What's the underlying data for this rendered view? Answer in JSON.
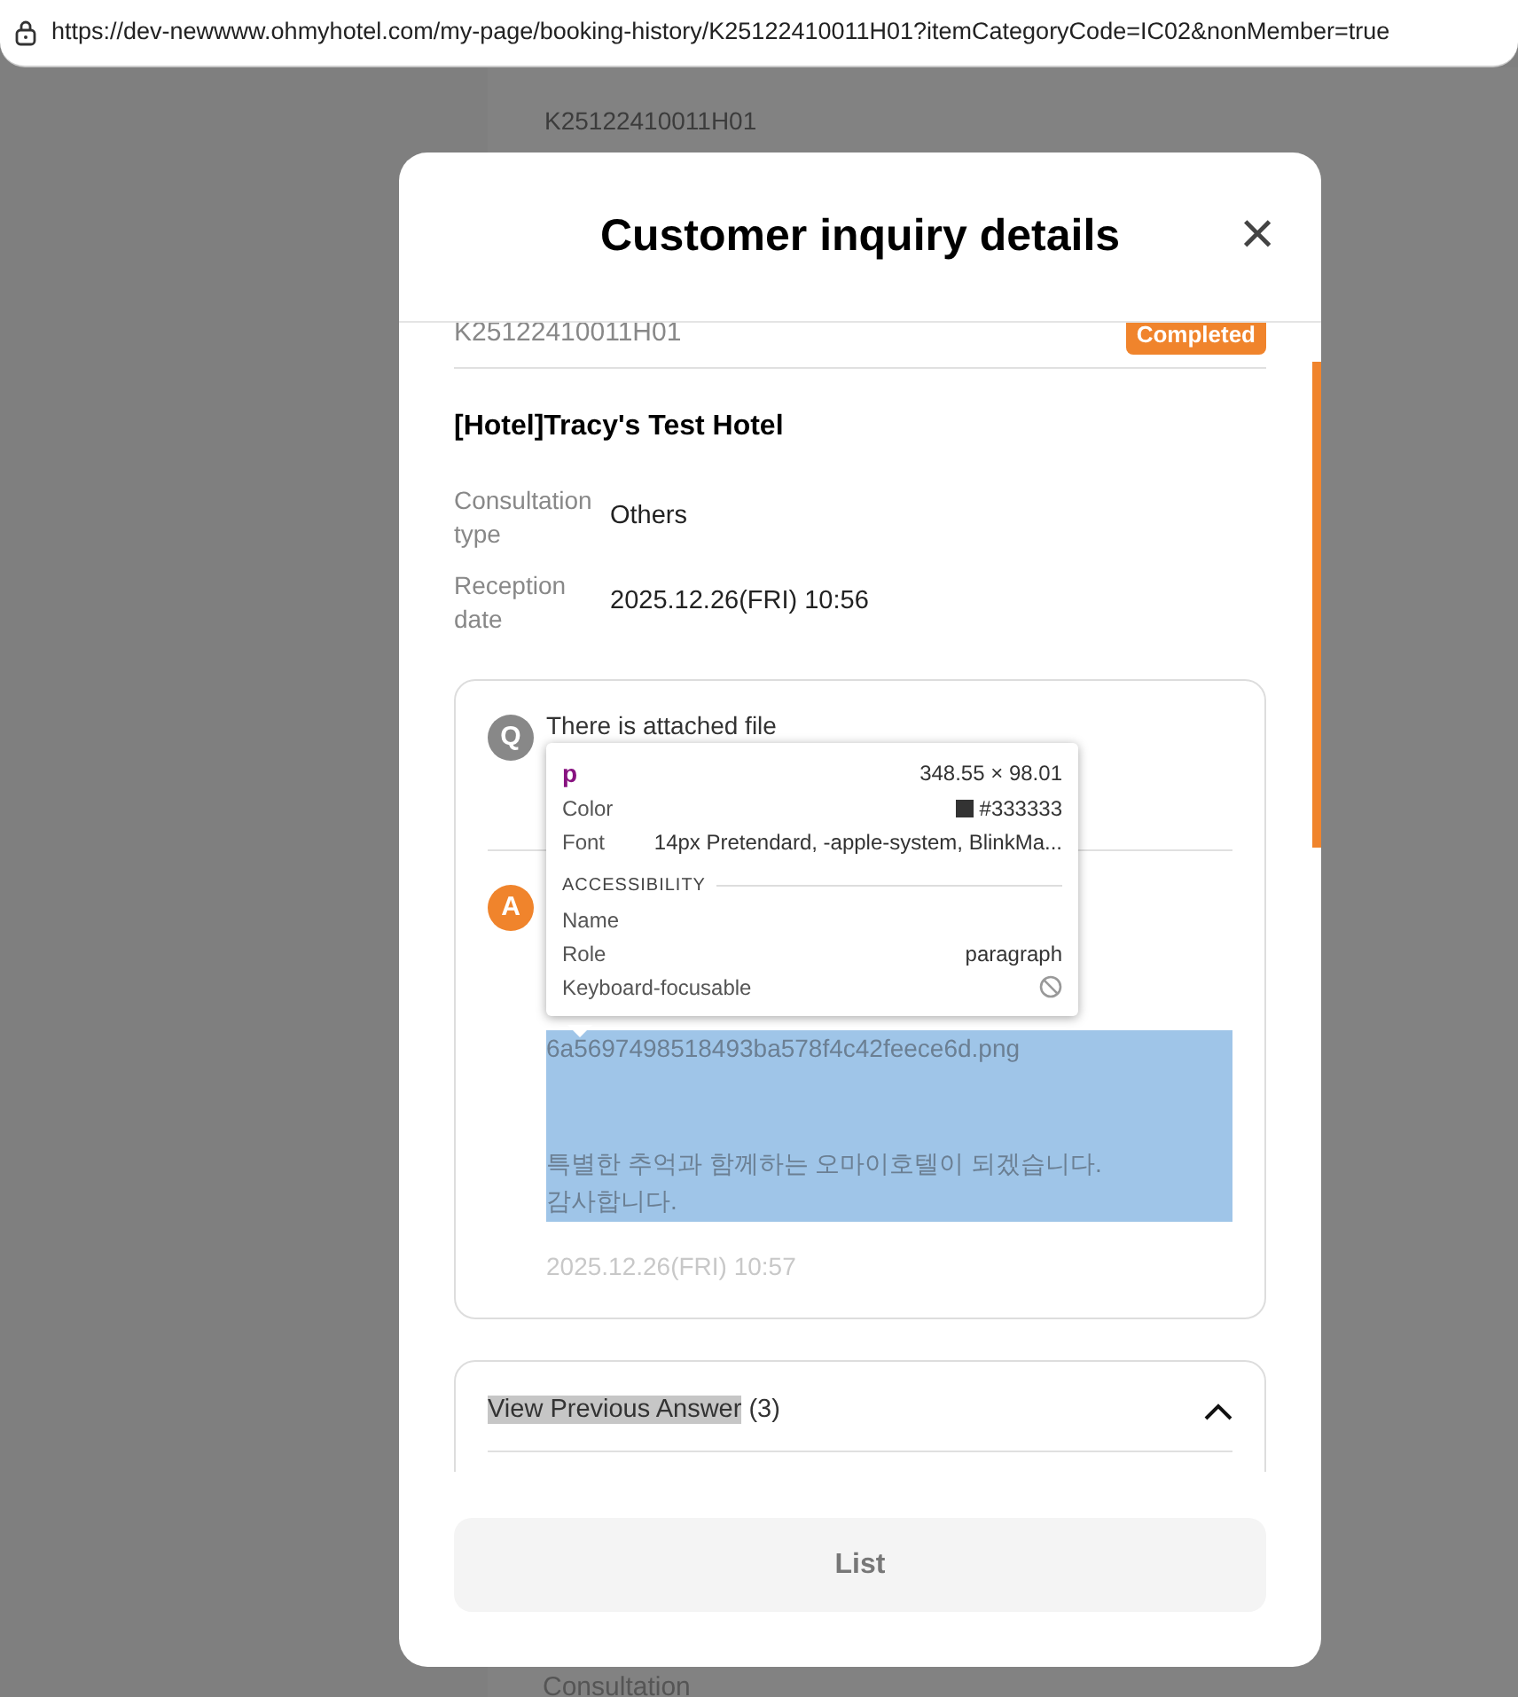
{
  "address_bar": {
    "url": "https://dev-newwww.ohmyhotel.com/my-page/booking-history/K25122410011H01?itemCategoryCode=IC02&nonMember=true"
  },
  "background_page": {
    "booking_number": "K25122410011H01",
    "bottom_label": "Consultation"
  },
  "modal": {
    "title": "Customer inquiry details",
    "close": "×",
    "reservation_number": "K25122410011H01",
    "status": {
      "label": "Completed",
      "color": "#f0842c"
    },
    "hotel_name": "[Hotel]Tracy's Test Hotel",
    "details": [
      {
        "label": "Consultation type",
        "value": "Others"
      },
      {
        "label": "Reception date",
        "value": "2025.12.26(FRI) 10:56"
      }
    ],
    "question": {
      "badge": "Q",
      "text": "There is attached file"
    },
    "answer": {
      "badge": "A",
      "highlighted": true,
      "file": "6a5697498518493ba578f4c42feece6d.png",
      "message_lines": [
        "특별한 추억과 함께하는 오마이호텔이 되겠습니다.",
        "감사합니다."
      ],
      "date": "2025.12.26(FRI) 10:57"
    },
    "previous_answers": {
      "label": "View Previous Answer",
      "label_highlighted": true,
      "count": "(3)",
      "expanded": true
    },
    "list_button": "List"
  },
  "inspector_tooltip": {
    "tag": "p",
    "size": "348.55 × 98.01",
    "rows": [
      {
        "label": "Color",
        "value": "#333333",
        "kind": "swatch"
      },
      {
        "label": "Font",
        "value": "14px Pretendard, -apple-system, BlinkMa...",
        "kind": "text"
      }
    ],
    "section_title": "ACCESSIBILITY",
    "accessibility": [
      {
        "label": "Name",
        "kind": "text"
      },
      {
        "label": "Role",
        "value": "paragraph",
        "kind": "text"
      },
      {
        "label": "Keyboard-focusable",
        "kind": "blocked"
      }
    ]
  }
}
